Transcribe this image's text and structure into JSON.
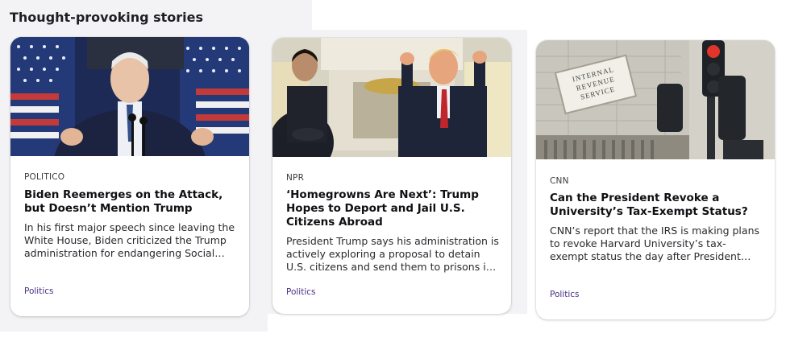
{
  "section": {
    "title": "Thought-provoking stories"
  },
  "cards": [
    {
      "source": "POLITICO",
      "headline": "Biden Reemerges on the Attack, but Doesn’t Mention Trump",
      "summary": "In his first major speech since leaving the White House, Biden criticized the Trump administration for endangering Social Security and the programs seniors rely on.",
      "category": "Politics",
      "image_icon": "photo-biden-speaking"
    },
    {
      "source": "NPR",
      "headline": "‘Homegrowns Are Next’: Trump Hopes to Deport and Jail U.S. Citizens Abroad",
      "summary": "President Trump says his administration is actively exploring a proposal to detain U.S. citizens and send them to prisons in El Salvador.",
      "category": "Politics",
      "image_icon": "photo-oval-office-meeting"
    },
    {
      "source": "CNN",
      "headline": "Can the President Revoke a University’s Tax-Exempt Status?",
      "summary": "CNN’s report that the IRS is making plans to revoke Harvard University’s tax-exempt status the day after President Trump threatened to do so.",
      "category": "Politics",
      "image_icon": "photo-irs-building",
      "image_text": [
        "INTERNAL",
        "REVENUE",
        "SERVICE"
      ]
    }
  ]
}
